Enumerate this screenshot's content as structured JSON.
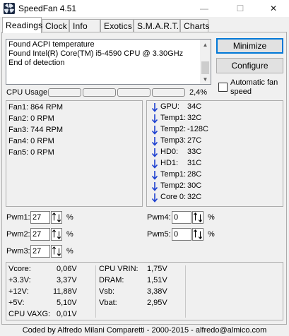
{
  "window": {
    "title": "SpeedFan 4.51",
    "minimize_glyph": "—",
    "maximize_glyph": "☐",
    "close_glyph": "✕"
  },
  "tabs": [
    {
      "label": "Readings",
      "active": true
    },
    {
      "label": "Clock"
    },
    {
      "label": "Info"
    },
    {
      "label": "Exotics"
    },
    {
      "label": "S.M.A.R.T."
    },
    {
      "label": "Charts"
    }
  ],
  "log": {
    "lines": [
      "Found ACPI temperature",
      "Found Intel(R) Core(TM) i5-4590 CPU @ 3.30GHz",
      "End of detection"
    ]
  },
  "buttons": {
    "minimize": "Minimize",
    "configure": "Configure"
  },
  "auto_fan": {
    "label_line1": "Automatic fan",
    "label_line2": "speed",
    "checked": false
  },
  "cpu_usage": {
    "label": "CPU Usage",
    "value": "2,4%"
  },
  "fans": [
    {
      "label": "Fan1: 864 RPM"
    },
    {
      "label": "Fan2: 0 RPM"
    },
    {
      "label": "Fan3: 744 RPM"
    },
    {
      "label": "Fan4: 0 RPM"
    },
    {
      "label": "Fan5: 0 RPM"
    }
  ],
  "temps": [
    {
      "name": "GPU:",
      "value": "34C"
    },
    {
      "name": "Temp1:",
      "value": "32C"
    },
    {
      "name": "Temp2:",
      "value": "-128C"
    },
    {
      "name": "Temp3:",
      "value": "27C"
    },
    {
      "name": "HD0:",
      "value": "33C"
    },
    {
      "name": "HD1:",
      "value": "31C"
    },
    {
      "name": "Temp1:",
      "value": "28C"
    },
    {
      "name": "Temp2:",
      "value": "30C"
    },
    {
      "name": "Core 0:",
      "value": "32C"
    }
  ],
  "pwm": {
    "pwm1": {
      "label": "Pwm1:",
      "value": "27",
      "unit": "%"
    },
    "pwm2": {
      "label": "Pwm2:",
      "value": "27",
      "unit": "%"
    },
    "pwm3": {
      "label": "Pwm3:",
      "value": "27",
      "unit": "%"
    },
    "pwm4": {
      "label": "Pwm4:",
      "value": "0",
      "unit": "%"
    },
    "pwm5": {
      "label": "Pwm5:",
      "value": "0",
      "unit": "%"
    }
  },
  "voltages_left": [
    {
      "name": "Vcore:",
      "value": "0,06V"
    },
    {
      "name": "+3.3V:",
      "value": "3,37V"
    },
    {
      "name": "+12V:",
      "value": "11,88V"
    },
    {
      "name": "+5V:",
      "value": "5,10V"
    },
    {
      "name": "CPU VAXG:",
      "value": "0,01V"
    }
  ],
  "voltages_right": [
    {
      "name": "CPU VRIN:",
      "value": "1,75V"
    },
    {
      "name": "DRAM:",
      "value": "1,51V"
    },
    {
      "name": "Vsb:",
      "value": "3,38V"
    },
    {
      "name": "Vbat:",
      "value": "2,95V"
    }
  ],
  "footer": "Coded by Alfredo Milani Comparetti - 2000-2015 - alfredo@almico.com",
  "colors": {
    "arrow": "#1c3fd0",
    "focus_border": "#0078d7"
  }
}
